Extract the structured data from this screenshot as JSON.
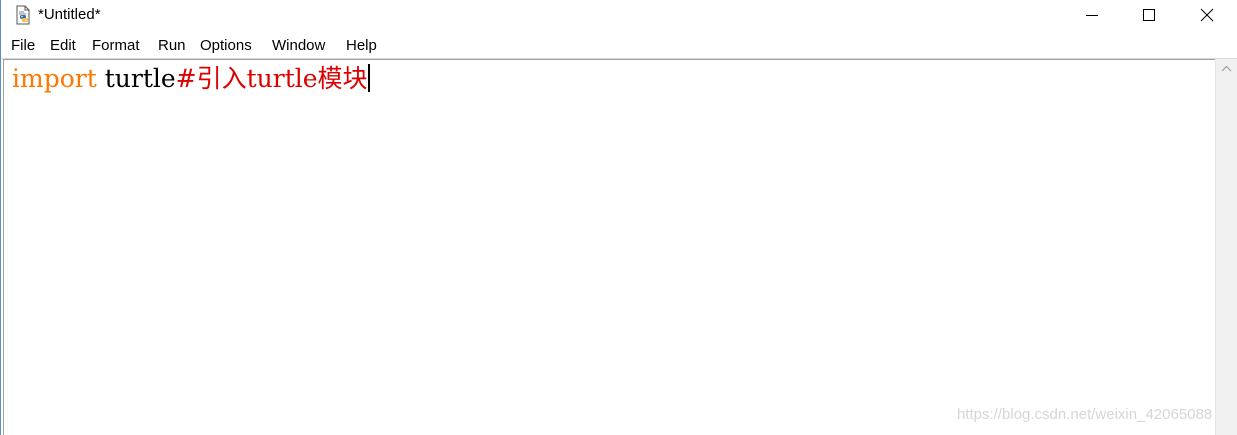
{
  "window": {
    "title": "*Untitled*",
    "icon": "python-idle-file-icon"
  },
  "controls": {
    "minimize_icon": "minimize-icon",
    "maximize_icon": "maximize-icon",
    "close_icon": "close-icon"
  },
  "menu": {
    "items": [
      "File",
      "Edit",
      "Format",
      "Run",
      "Options",
      "Window",
      "Help"
    ]
  },
  "editor": {
    "tokens": {
      "keyword": "import",
      "space": " ",
      "module": "turtle",
      "comment": "#引入turtle模块"
    }
  },
  "scrollbar": {
    "up_arrow_icon": "chevron-up-icon"
  },
  "watermark": "https://blog.csdn.net/weixin_42065088",
  "colors": {
    "keyword": "#ff7700",
    "comment": "#dd0000",
    "text": "#000000"
  }
}
